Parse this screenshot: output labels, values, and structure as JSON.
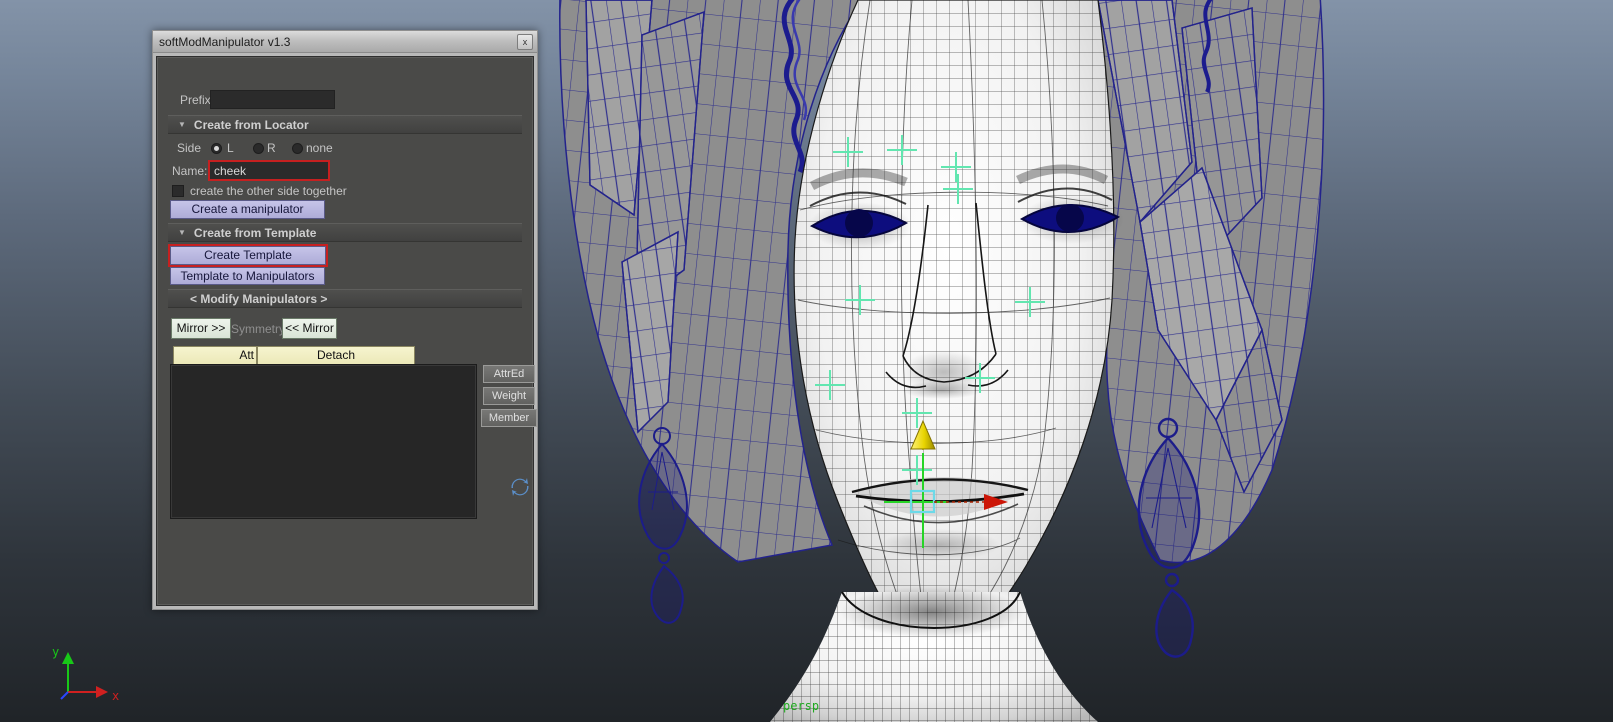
{
  "window": {
    "title": "softModManipulator v1.3",
    "close_label": "x"
  },
  "panel": {
    "prefix": {
      "label": "Prefix:",
      "value": ""
    },
    "sections": {
      "locator_title": "Create from Locator",
      "template_title": "Create from Template",
      "modify_title": "< Modify Manipulators >",
      "collapse_icon": "▼"
    },
    "side": {
      "label": "Side",
      "options": [
        {
          "label": "L",
          "selected": true
        },
        {
          "label": "R",
          "selected": false
        },
        {
          "label": "none",
          "selected": false
        }
      ]
    },
    "name_field": {
      "label": "Name:",
      "value": "cheek"
    },
    "other_side_checkbox": {
      "label": "create the other side together",
      "checked": false
    },
    "buttons": {
      "create_manipulator": "Create a manipulator",
      "create_template": "Create Template",
      "template_to_manipulators": "Template to Manipulators",
      "mirror_right": "Mirror >>",
      "symmetry": "Symmetry",
      "mirror_left": "<< Mirror",
      "attach_truncated": "Att",
      "detach": "Detach",
      "attred": "AttrEd",
      "weight": "Weight",
      "member": "Member"
    },
    "list": {
      "items": []
    }
  },
  "viewport": {
    "camera_label": "persp",
    "axis": {
      "x_label": "x",
      "y_label": "y"
    },
    "colors": {
      "bg_top": "#8393a8",
      "bg_bottom": "#202428",
      "wire_face": "#141414",
      "wire_hair": "#23238c",
      "eye_fill": "#0d0d7e",
      "manip_green": "#27d427",
      "locator_green": "#62e6b0",
      "manip_yellow": "#f0df18",
      "manip_red": "#cc1607",
      "manip_cyan": "#6cd9e8",
      "highlight_red": "#c62020"
    }
  }
}
